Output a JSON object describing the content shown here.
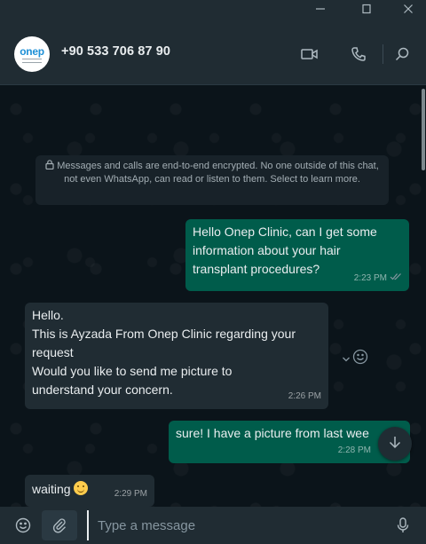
{
  "window": {
    "controls": [
      "minimize-icon",
      "maximize-icon",
      "close-icon"
    ]
  },
  "header": {
    "contact_name": "+90 533 706 87 90",
    "avatar_logo": "onep",
    "icons": [
      "video-call-icon",
      "voice-call-icon",
      "search-icon"
    ]
  },
  "chat": {
    "encryption_notice": "Messages and calls are end-to-end encrypted. No one outside of this chat, not even WhatsApp, can read or listen to them. Select to learn more.",
    "messages": [
      {
        "direction": "outgoing",
        "lines": [
          "Hello Onep Clinic, can I get some",
          "information about your hair",
          "transplant procedures?"
        ],
        "time": "2:23 PM",
        "status": "read"
      },
      {
        "direction": "incoming",
        "lines": [
          "Hello.",
          "This is Ayzada From Onep Clinic regarding your",
          "request",
          "Would you like to send me picture to",
          "understand your concern."
        ],
        "time": "2:26 PM"
      },
      {
        "direction": "outgoing",
        "lines": [
          "sure! I have a picture from last wee"
        ],
        "time": "2:28 PM"
      },
      {
        "direction": "incoming",
        "lines": [
          "waiting"
        ],
        "time": "2:29 PM",
        "emoji": "slightly-smiling-face"
      }
    ]
  },
  "composer": {
    "placeholder": "Type a message",
    "icons": [
      "emoji-icon",
      "attach-icon",
      "microphone-icon"
    ]
  },
  "colors": {
    "outgoing_bubble": "#005c4b",
    "incoming_bubble": "#202c33",
    "background": "#0b141a",
    "panel": "#202c33"
  }
}
